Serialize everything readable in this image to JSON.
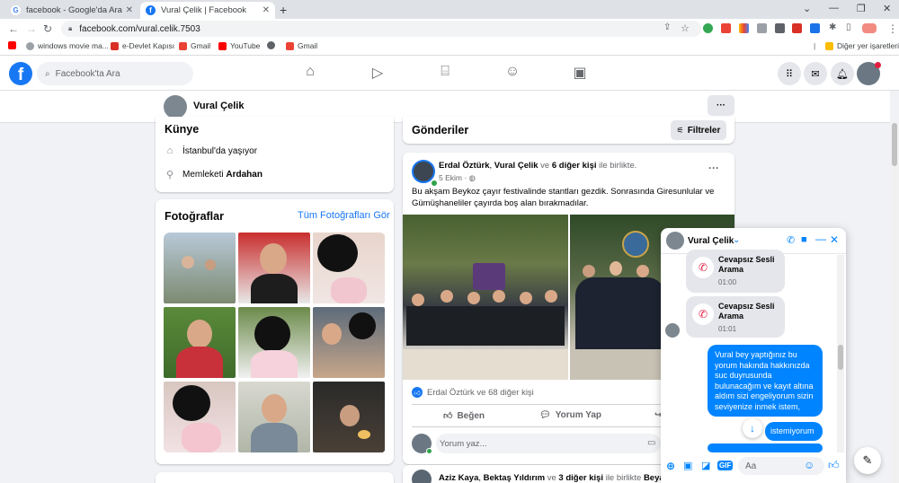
{
  "browser": {
    "tabs": [
      {
        "title": "facebook - Google'da Ara",
        "active": false
      },
      {
        "title": "Vural Çelik | Facebook",
        "active": true
      }
    ],
    "url": "facebook.com/vural.celik.7503",
    "bookmarks": [
      "windows movie ma...",
      "e-Devlet Kapısı",
      "Gmail",
      "YouTube",
      "Gmail"
    ],
    "other_bookmarks": "Diğer yer işaretleri"
  },
  "fb": {
    "search_placeholder": "Facebook'ta Ara"
  },
  "profile": {
    "name": "Vural Çelik",
    "more": "···"
  },
  "intro": {
    "title": "Künye",
    "lives": "İstanbul",
    "lives_suffix": "'da yaşıyor",
    "from_prefix": "Memleketi ",
    "from": "Ardahan"
  },
  "photos": {
    "title": "Fotoğraflar",
    "see_all": "Tüm Fotoğrafları Gör"
  },
  "posts": {
    "title": "Gönderiler",
    "filters": "Filtreler"
  },
  "post1": {
    "author1": "Erdal Öztürk",
    "sep": ", ",
    "author2": "Vural Çelik",
    "with": " ve ",
    "others": "6 diğer kişi",
    "tail": " ile birlikte.",
    "date": "5 Ekim · ",
    "text": "Bu akşam Beykoz çayır festivalinde stantları gezdik. Sonrasında Giresunlular ve Gümüşhaneliler çayırda boş alan bırakmadılar.",
    "reactions": "Erdal Öztürk ve 68 diğer kişi",
    "like": "Beğen",
    "comment": "Yorum Yap",
    "comment_placeholder": "Yorum yaz..."
  },
  "post2": {
    "author1": "Aziz Kaya",
    "sep": ", ",
    "author2": "Bektaş Yıldırım",
    "with": " ve ",
    "others": "3 diğer kişi",
    "tail": " ile birlikte ",
    "place": "Beyaz S"
  },
  "chat": {
    "name": "Vural Çelik",
    "missed1": {
      "label": "Cevapsız Sesli Arama",
      "time": "01:00"
    },
    "missed2": {
      "label": "Cevapsız Sesli Arama",
      "time": "01:01"
    },
    "msg1": "Vural bey yaptığınız bu yorum hakında hakkınızda suc duyrusunda bulunacağım ve kayıt altına aldım sizi engeliyorum sizin seviyenize inmek istem,",
    "msg2": "istemiyorum",
    "input_placeholder": "Aa",
    "gif": "GIF"
  },
  "colors": {
    "fb_blue": "#1877f2",
    "messenger_blue": "#0084ff",
    "missed_red": "#e41e3f"
  }
}
